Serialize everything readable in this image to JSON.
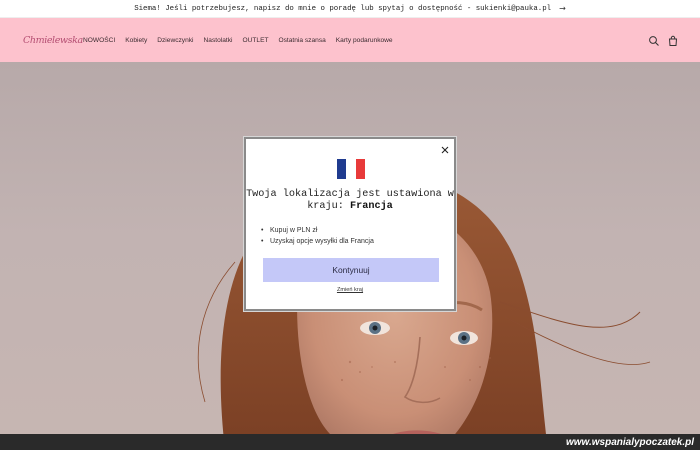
{
  "announcement": {
    "text": "Siema! Jeśli potrzebujesz, napisz do mnie o poradę lub spytaj o dostępność - sukienki@pauka.pl",
    "arrow_icon": "arrow-right-icon"
  },
  "header": {
    "logo": {
      "small_text": "...",
      "main_text": "Chmielewska"
    },
    "nav": [
      {
        "label": "NOWOŚCI"
      },
      {
        "label": "Kobiety"
      },
      {
        "label": "Dziewczynki"
      },
      {
        "label": "Nastolatki"
      },
      {
        "label": "OUTLET"
      },
      {
        "label": "Ostatnia szansa"
      },
      {
        "label": "Karty podarunkowe"
      }
    ],
    "icons": [
      "search-icon",
      "cart-icon"
    ]
  },
  "modal": {
    "flag": {
      "country": "France",
      "colors": [
        "#1f3b8f",
        "#ffffff",
        "#e83a3a"
      ]
    },
    "title_prefix": "Twoja lokalizacja jest ustawiona w kraju:",
    "title_country": "Francja",
    "bullets": [
      "Kupuj w PLN zł",
      "Uzyskaj opcje wysyłki dla Francja"
    ],
    "continue_label": "Kontynuuj",
    "change_label": "Zmień kraj",
    "close_icon": "close-icon"
  },
  "watermark": {
    "text": "www.wspanialypoczatek.pl"
  },
  "colors": {
    "header_bg": "#fdc2cd",
    "button_bg": "#c4c8f8",
    "hero_bg": "#b7a9a9",
    "watermark_bg": "#2a2a2a"
  }
}
